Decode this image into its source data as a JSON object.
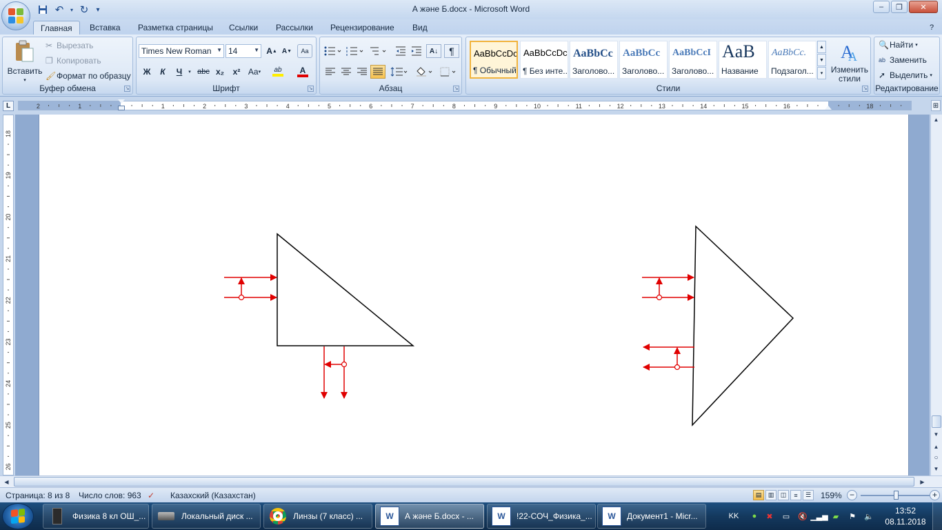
{
  "window": {
    "title": "А және Б.docx - Microsoft Word",
    "minimize": "–",
    "maximize": "❐",
    "close": "✕"
  },
  "qat": {
    "save": "💾",
    "undo": "↶",
    "redo": "↻",
    "customize": "▾"
  },
  "tabs": [
    "Главная",
    "Вставка",
    "Разметка страницы",
    "Ссылки",
    "Рассылки",
    "Рецензирование",
    "Вид"
  ],
  "active_tab": "Главная",
  "ribbon": {
    "clipboard": {
      "label": "Буфер обмена",
      "paste": "Вставить",
      "cut": "Вырезать",
      "copy": "Копировать",
      "format_painter": "Формат по образцу"
    },
    "font": {
      "label": "Шрифт",
      "font_name": "Times New Roman",
      "font_size": "14",
      "grow": "A",
      "shrink": "A",
      "clear": "Aa",
      "bold": "Ж",
      "italic": "К",
      "underline": "Ч",
      "strike": "abc",
      "subscript": "x₂",
      "superscript": "x²",
      "case": "Aa",
      "highlight": "ab",
      "font_color": "A",
      "highlight_color": "#ffee00",
      "font_color_value": "#e00000"
    },
    "paragraph": {
      "label": "Абзац",
      "pilcrow": "¶"
    },
    "styles": {
      "label": "Стили",
      "items": [
        {
          "sample": "AaBbCcDc",
          "name": "¶ Обычный"
        },
        {
          "sample": "AaBbCcDc",
          "name": "¶ Без инте..."
        },
        {
          "sample": "AaBbCc",
          "name": "Заголово..."
        },
        {
          "sample": "AaBbCc",
          "name": "Заголово..."
        },
        {
          "sample": "AaBbCcI",
          "name": "Заголово..."
        },
        {
          "sample": "AaB",
          "name": "Название"
        },
        {
          "sample": "AaBbCc.",
          "name": "Подзагол..."
        }
      ],
      "change_styles": "Изменить стили"
    },
    "editing": {
      "label": "Редактирование",
      "find": "Найти",
      "replace": "Заменить",
      "select": "Выделить"
    }
  },
  "ruler": {
    "h_numbers": [
      "2",
      "1",
      "1",
      "2",
      "3",
      "4",
      "5",
      "6",
      "7",
      "8",
      "9",
      "10",
      "11",
      "12",
      "13",
      "14",
      "15",
      "16",
      "18"
    ],
    "v_numbers": [
      "18",
      "19",
      "20",
      "21",
      "22",
      "23",
      "24",
      "25",
      "26"
    ],
    "corner": "L"
  },
  "drawing": {
    "arrow_color": "#e00000",
    "shape_color": "#000000"
  },
  "status": {
    "page": "Страница: 8 из 8",
    "words": "Число слов: 963",
    "language": "Казахский (Казахстан)",
    "zoom": "159%"
  },
  "taskbar": {
    "items": [
      {
        "label": "Физика 8 кл ОШ_...",
        "icon": "book-icon"
      },
      {
        "label": "Локальный диск ...",
        "icon": "drive-icon"
      },
      {
        "label": "Линзы (7 класс) ...",
        "icon": "chrome-icon"
      },
      {
        "label": "А және Б.docx - ...",
        "icon": "word-icon"
      },
      {
        "label": "!22-СОЧ_Физика_...",
        "icon": "word-icon"
      },
      {
        "label": "Документ1 - Micr...",
        "icon": "word-icon"
      }
    ],
    "lang": "KK",
    "time": "13:52",
    "date": "08.11.2018"
  }
}
